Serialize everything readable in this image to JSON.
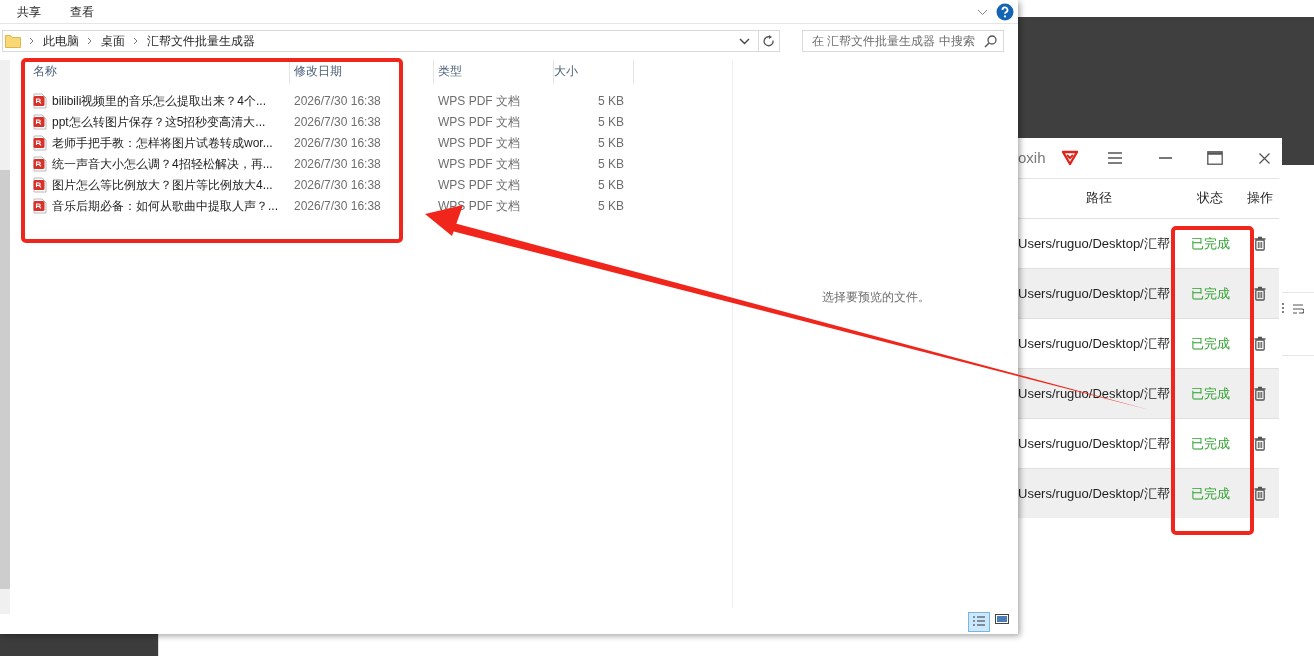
{
  "explorer": {
    "ribbon_tabs": [
      {
        "label": "共享"
      },
      {
        "label": "查看"
      }
    ],
    "breadcrumb": [
      "此电脑",
      "桌面",
      "汇帮文件批量生成器"
    ],
    "search": {
      "placeholder": "在 汇帮文件批量生成器 中搜索"
    },
    "columns": [
      "名称",
      "修改日期",
      "类型",
      "大小"
    ],
    "files": [
      {
        "name": "bilibili视频里的音乐怎么提取出来？4个...",
        "modified": "2026/7/30 16:38",
        "type": "WPS PDF 文档",
        "size": "5 KB"
      },
      {
        "name": "ppt怎么转图片保存？这5招秒变高清大...",
        "modified": "2026/7/30 16:38",
        "type": "WPS PDF 文档",
        "size": "5 KB"
      },
      {
        "name": "老师手把手教：怎样将图片试卷转成wor...",
        "modified": "2026/7/30 16:38",
        "type": "WPS PDF 文档",
        "size": "5 KB"
      },
      {
        "name": "统一声音大小怎么调？4招轻松解决，再...",
        "modified": "2026/7/30 16:38",
        "type": "WPS PDF 文档",
        "size": "5 KB"
      },
      {
        "name": "图片怎么等比例放大？图片等比例放大4...",
        "modified": "2026/7/30 16:38",
        "type": "WPS PDF 文档",
        "size": "5 KB"
      },
      {
        "name": "音乐后期必备：如何从歌曲中提取人声？...",
        "modified": "2026/7/30 16:38",
        "type": "WPS PDF 文档",
        "size": "5 KB"
      }
    ],
    "preview_message": "选择要预览的文件。"
  },
  "app": {
    "title": "oxih",
    "columns": [
      "路径",
      "状态",
      "操作"
    ],
    "rows": [
      {
        "path": "Users/ruguo/Desktop/汇帮",
        "status": "已完成"
      },
      {
        "path": "Users/ruguo/Desktop/汇帮",
        "status": "已完成"
      },
      {
        "path": "Users/ruguo/Desktop/汇帮",
        "status": "已完成"
      },
      {
        "path": "Users/ruguo/Desktop/汇帮",
        "status": "已完成"
      },
      {
        "path": "Users/ruguo/Desktop/汇帮",
        "status": "已完成"
      },
      {
        "path": "Users/ruguo/Desktop/汇帮",
        "status": "已完成"
      }
    ]
  }
}
